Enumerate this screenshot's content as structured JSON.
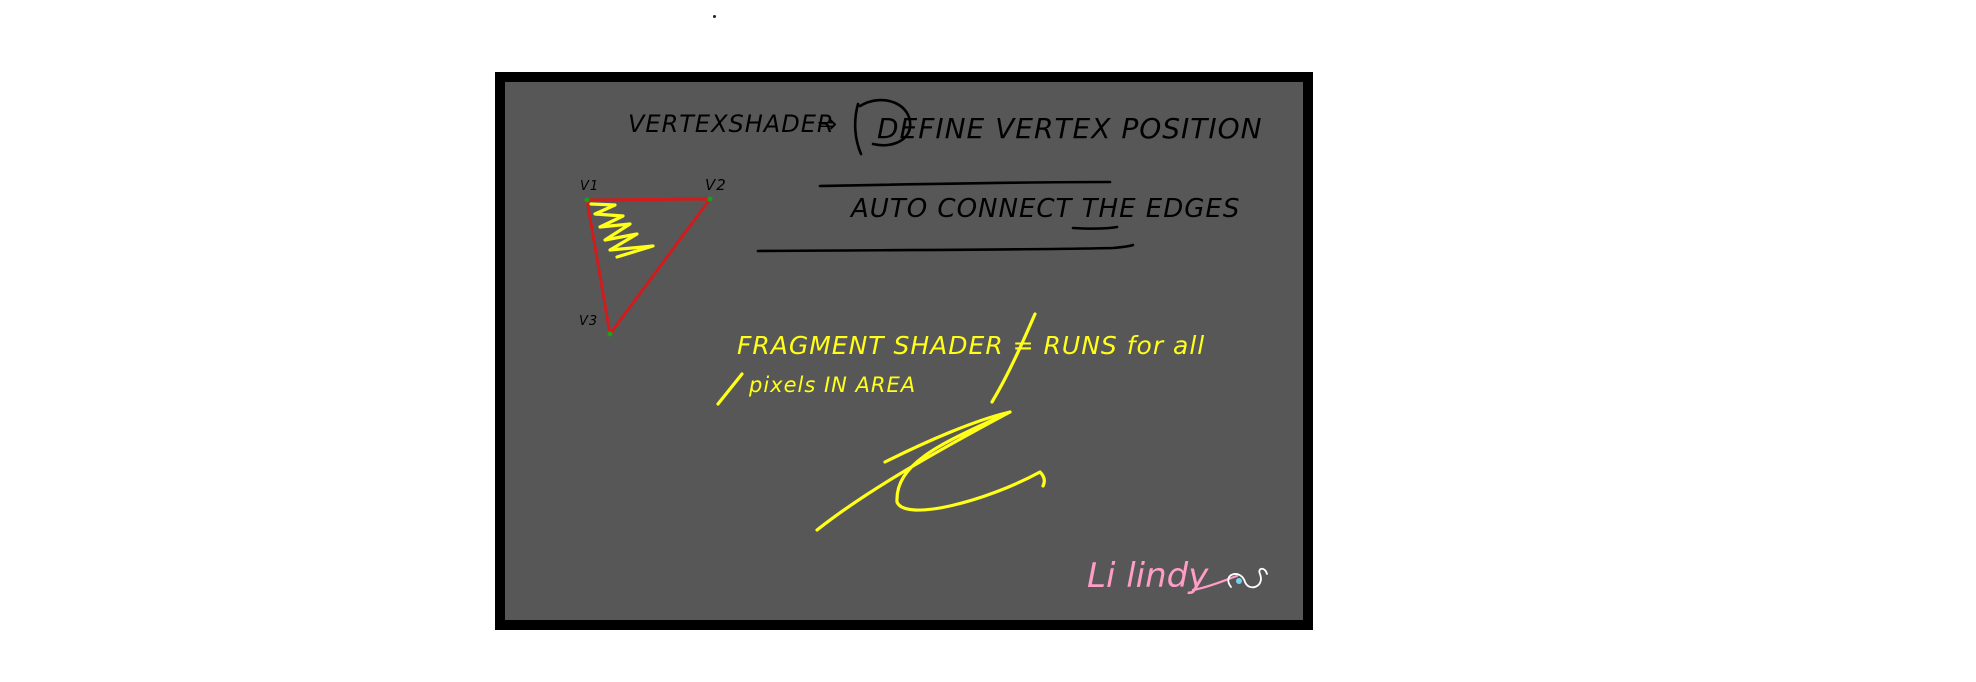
{
  "board": {
    "heading_left": "VERTEXSHADER",
    "heading_arrow": "⇒",
    "heading_right": "DEFINE VERTEX POSITION",
    "subheading": "AUTO CONNECT THE EDGES",
    "triangle_labels": {
      "v1": "V1",
      "v2": "V2",
      "v3": "V3"
    },
    "fragment_line1": "FRAGMENT SHADER = RUNS for all",
    "fragment_line2": "pixels IN AREA",
    "signature": "Li lindy"
  },
  "colors": {
    "background": "#ffffff",
    "frame": "#000000",
    "board": "#575757",
    "ink_black": "#000000",
    "ink_yellow": "#ffff1a",
    "ink_red": "#d01c1c",
    "ink_pink": "#ff9dc6",
    "vertex_dot": "#1aa01a"
  }
}
